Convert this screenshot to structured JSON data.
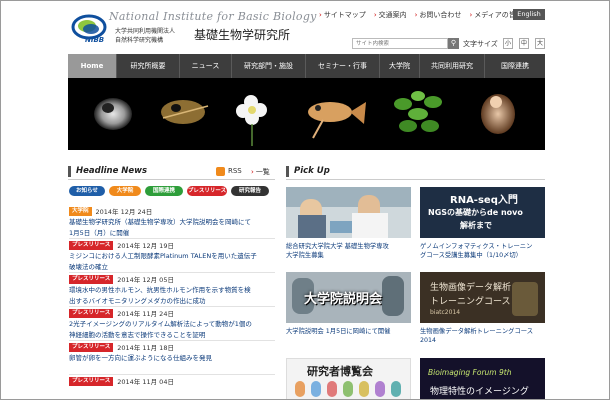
{
  "header": {
    "org_en": "National Institute for Basic Biology",
    "org_jp_line1": "大学共同利用機関法人",
    "org_jp_line2": "自然科学研究機構",
    "org_jp_name": "基礎生物学研究所",
    "logo_text": "NIBB",
    "utility_links": [
      "サイトマップ",
      "交通案内",
      "お問い合わせ",
      "メディアの皆様へ"
    ],
    "english_label": "English",
    "search_placeholder": "サイト内検索",
    "font_size_label": "文字サイズ",
    "font_sizes": [
      "小",
      "中",
      "大"
    ]
  },
  "nav": {
    "items": [
      "Home",
      "研究所概要",
      "ニュース",
      "研究部門・施設",
      "セミナー・行事",
      "大学院",
      "共同利用研究",
      "国際連携"
    ],
    "active_index": 0
  },
  "headline": {
    "title": "Headline News",
    "rss_label": "RSS",
    "list_label": "一覧",
    "categories": [
      {
        "label": "お知らせ",
        "color": "#1f5ea8"
      },
      {
        "label": "大学院",
        "color": "#f08a1c"
      },
      {
        "label": "国際連携",
        "color": "#2e9e3a"
      },
      {
        "label": "プレスリリース",
        "color": "#d6262a"
      },
      {
        "label": "研究報告",
        "color": "#333333"
      }
    ],
    "items": [
      {
        "tag": "大学院",
        "tag_color": "#f08a1c",
        "date": "2014年 12月 24日",
        "lines": [
          "基礎生物学研究所（基礎生物学専攻）大学院説明会を岡崎にて",
          "1月5日（月）に開催"
        ]
      },
      {
        "tag": "プレスリリース",
        "tag_color": "#d6262a",
        "date": "2014年 12月 19日",
        "lines": [
          "ミジンコにおける人工制限酵素Platinum TALENを用いた遺伝子",
          "破壊法の確立"
        ]
      },
      {
        "tag": "プレスリリース",
        "tag_color": "#d6262a",
        "date": "2014年 12月 05日",
        "lines": [
          "環境水中の男性ホルモン、抗男性ホルモン作用を示す物質を検",
          "出するバイオモニタリングメダカの作出に成功"
        ]
      },
      {
        "tag": "プレスリリース",
        "tag_color": "#d6262a",
        "date": "2014年 11月 24日",
        "lines": [
          "2光子イメージングのリアルタイム解析法によって動物が1個の",
          "神経細胞の活動を意志で操作できることを証明"
        ]
      },
      {
        "tag": "プレスリリース",
        "tag_color": "#d6262a",
        "date": "2014年 11月 18日",
        "lines": [
          "卵管が卵を一方向に運ぶようになる仕組みを発見"
        ]
      },
      {
        "tag": "プレスリリース",
        "tag_color": "#d6262a",
        "date": "2014年 11月 04日",
        "lines": [
          ""
        ]
      }
    ]
  },
  "pickup": {
    "title": "Pick Up",
    "items": [
      {
        "caption": [
          "総合研究大学院大学 基礎生物学専攻",
          "大学院生募集"
        ],
        "overlay": ""
      },
      {
        "caption": [
          "ゲノムインフォマティクス・トレーニン",
          "グコース受講生募集中（1/10〆切）"
        ],
        "overlay": "RNA-seq入門|NGSの基礎からde novo|解析まで"
      },
      {
        "caption": [
          "大学院説明会 1月5日に岡崎にて開催"
        ],
        "overlay": "大学院説明会"
      },
      {
        "caption": [
          "生物画像データ解析トレーニングコース",
          "2014"
        ],
        "overlay": "生物画像データ解析|トレーニングコース|biatc2014"
      },
      {
        "caption": [
          ""
        ],
        "overlay": "研究者博覧会"
      },
      {
        "caption": [
          ""
        ],
        "overlay": "Bioimaging Forum 9th|物理特性のイメージング"
      }
    ]
  },
  "colors": {
    "nav_bg": "#3d3d3d",
    "nav_active": "#999999",
    "link_blue": "#0b3a7a",
    "accent_red": "#cc0000"
  }
}
